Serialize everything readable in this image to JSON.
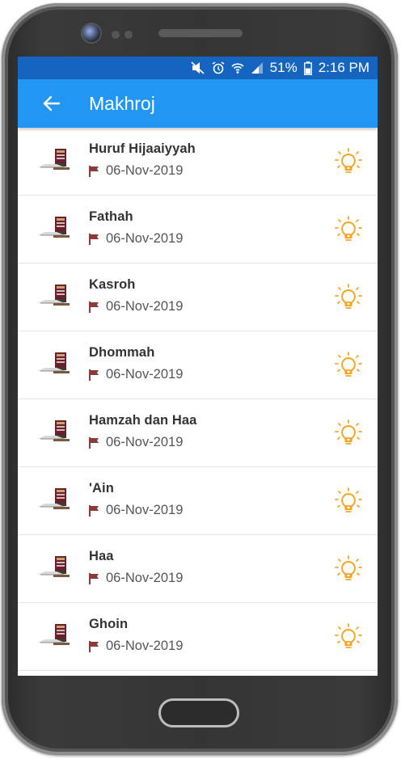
{
  "status": {
    "battery": "51%",
    "time": "2:16 PM",
    "icons": [
      "mute-icon",
      "alarm-icon",
      "wifi-icon",
      "signal-icon",
      "battery-icon"
    ]
  },
  "appbar": {
    "title": "Makhroj",
    "back_icon": "arrow-back-icon"
  },
  "colors": {
    "appbar": "#2196f3",
    "statusbar": "#1565c0",
    "bulb": "#f5a623",
    "flag": "#8b3a3a"
  },
  "items": [
    {
      "title": "Huruf Hijaaiyyah",
      "date": "06-Nov-2019"
    },
    {
      "title": "Fathah",
      "date": "06-Nov-2019"
    },
    {
      "title": "Kasroh",
      "date": "06-Nov-2019"
    },
    {
      "title": "Dhommah",
      "date": "06-Nov-2019"
    },
    {
      "title": "Hamzah dan Haa",
      "date": "06-Nov-2019"
    },
    {
      "title": "'Ain",
      "date": "06-Nov-2019"
    },
    {
      "title": "Haa",
      "date": "06-Nov-2019"
    },
    {
      "title": "Ghoin",
      "date": "06-Nov-2019"
    }
  ]
}
